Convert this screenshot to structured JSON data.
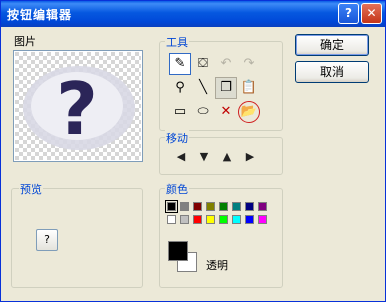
{
  "window": {
    "title": "按钮编辑器"
  },
  "title_buttons": {
    "help": "?",
    "close": "✕"
  },
  "picture": {
    "label": "图片",
    "glyph": "?"
  },
  "preview": {
    "label": "预览",
    "button_text": "?"
  },
  "tools": {
    "label": "工具",
    "items": [
      {
        "name": "pencil",
        "glyph": "✎",
        "state": "active"
      },
      {
        "name": "fill-bucket",
        "glyph": "⛋",
        "state": "normal"
      },
      {
        "name": "undo",
        "glyph": "↶",
        "state": "disabled"
      },
      {
        "name": "redo",
        "glyph": "↷",
        "state": "disabled"
      },
      {
        "name": "eyedropper",
        "glyph": "⚲",
        "state": "normal"
      },
      {
        "name": "line",
        "glyph": "╲",
        "state": "normal"
      },
      {
        "name": "copy",
        "glyph": "❐",
        "state": "pressed"
      },
      {
        "name": "paste",
        "glyph": "📋",
        "state": "normal"
      },
      {
        "name": "rectangle",
        "glyph": "▭",
        "state": "normal"
      },
      {
        "name": "ellipse",
        "glyph": "⬭",
        "state": "normal"
      },
      {
        "name": "clear",
        "glyph": "✕",
        "state": "normal"
      },
      {
        "name": "open",
        "glyph": "📂",
        "state": "normal"
      }
    ]
  },
  "move": {
    "label": "移动",
    "items": [
      {
        "name": "left",
        "glyph": "◀"
      },
      {
        "name": "down",
        "glyph": "▼"
      },
      {
        "name": "up",
        "glyph": "▲"
      },
      {
        "name": "right",
        "glyph": "▶"
      }
    ]
  },
  "colors": {
    "label": "颜色",
    "palette": [
      "#000000",
      "#808080",
      "#800000",
      "#808000",
      "#008000",
      "#008080",
      "#000080",
      "#800080",
      "#ffffff",
      "#c0c0c0",
      "#ff0000",
      "#ffff00",
      "#00ff00",
      "#00ffff",
      "#0000ff",
      "#ff00ff"
    ],
    "foreground": "#000000",
    "background": "#ffffff",
    "transparent_label": "透明"
  },
  "buttons": {
    "ok": "确定",
    "cancel": "取消"
  }
}
